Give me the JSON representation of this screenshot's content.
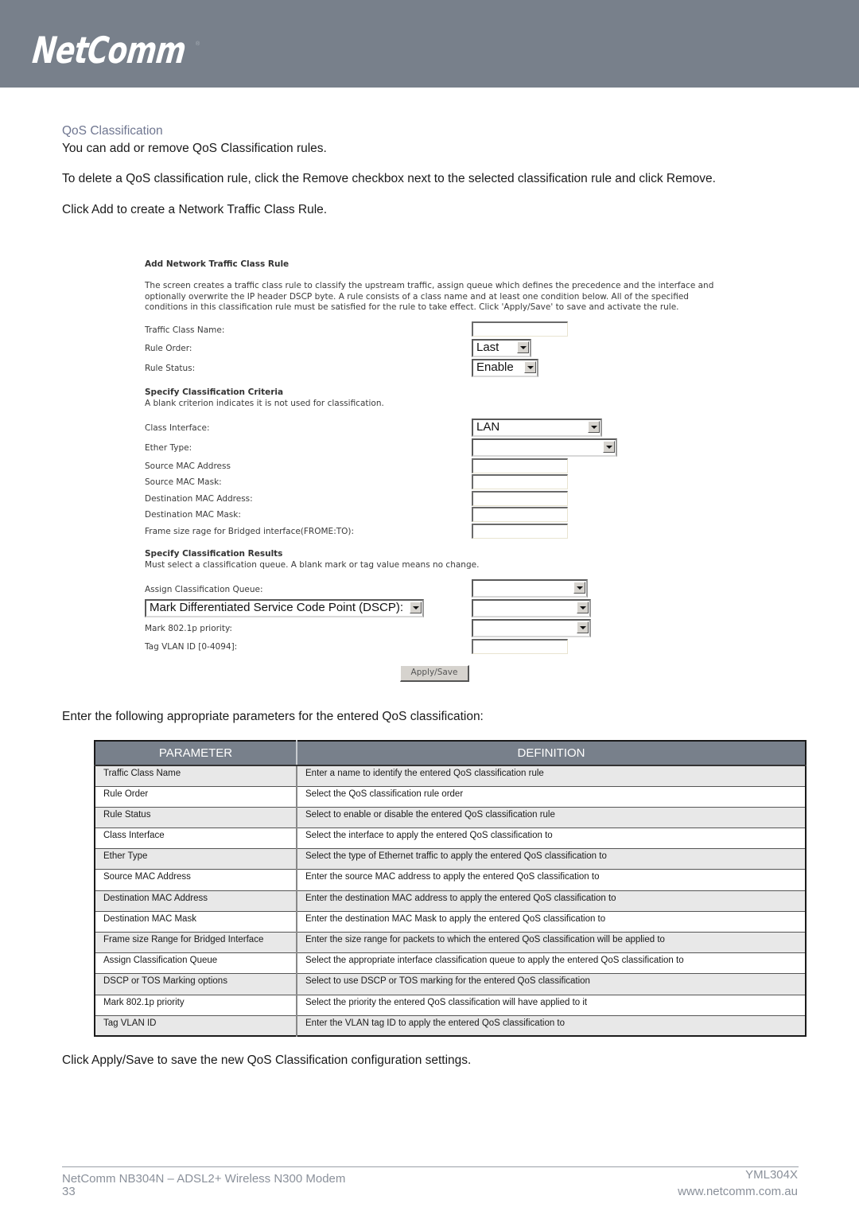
{
  "header": {
    "brand": "NetComm",
    "registered_mark": "®"
  },
  "section": {
    "title": "QoS Classification",
    "paragraphs": [
      "You can add or remove QoS Classification rules.",
      "To delete a QoS classification rule, click the Remove checkbox next to the selected classification rule and click Remove.",
      "Click Add to create a Network Traffic Class Rule."
    ]
  },
  "router_ui": {
    "title": "Add Network Traffic Class Rule",
    "description": "The screen creates a traffic class rule to classify the upstream traffic, assign queue which defines the precedence and the interface and optionally overwrite the IP header DSCP byte. A rule consists of a class name and at least one condition below. All of the specified conditions in this classification rule must be satisfied for the rule to take effect. Click 'Apply/Save' to save and activate the rule.",
    "traffic_class_name_label": "Traffic Class Name:",
    "traffic_class_name_value": "",
    "rule_order_label": "Rule Order:",
    "rule_order_value": "Last",
    "rule_status_label": "Rule Status:",
    "rule_status_value": "Enable",
    "criteria_title": "Specify Classification Criteria",
    "criteria_note": "A blank criterion indicates it is not used for classification.",
    "class_interface_label": "Class Interface:",
    "class_interface_value": "LAN",
    "ether_type_label": "Ether Type:",
    "ether_type_value": "",
    "src_mac_label": "Source MAC Address",
    "src_mac_value": "",
    "src_mask_label": "Source MAC Mask:",
    "src_mask_value": "",
    "dst_mac_label": "Destination MAC Address:",
    "dst_mac_value": "",
    "dst_mask_label": "Destination MAC Mask:",
    "dst_mask_value": "",
    "frame_size_label": "Frame size rage for Bridged interface(FROME:TO):",
    "frame_size_value": "",
    "results_title": "Specify Classification Results",
    "results_note": "Must select a classification queue. A blank mark or tag value means no change.",
    "queue_label": "Assign Classification Queue:",
    "queue_value": "",
    "dscp_select_value": "Mark Differentiated Service Code Point (DSCP):",
    "dscp_value": "",
    "priority_label": "Mark 802.1p priority:",
    "priority_value": "",
    "vlan_label": "Tag VLAN ID [0-4094]:",
    "vlan_value": "",
    "apply_button": "Apply/Save"
  },
  "table_intro": "Enter the following appropriate parameters for the entered QoS classification:",
  "table": {
    "headers": [
      "PARAMETER",
      "DEFINITION"
    ],
    "rows": [
      {
        "param": "Traffic Class Name",
        "definition": "Enter a name to identify the entered QoS classification rule"
      },
      {
        "param": "Rule Order",
        "definition": "Select the QoS classification rule order"
      },
      {
        "param": "Rule Status",
        "definition": "Select to enable or disable the entered QoS classification rule"
      },
      {
        "param": "Class Interface",
        "definition": "Select the interface to apply the entered QoS classification to"
      },
      {
        "param": "Ether Type",
        "definition": "Select the type of Ethernet traffic to apply the entered QoS classification to"
      },
      {
        "param": "Source MAC Address",
        "definition": "Enter the source MAC address to apply the entered QoS classification to"
      },
      {
        "param": "Destination MAC Address",
        "definition": "Enter the destination MAC address to apply the entered QoS classification to"
      },
      {
        "param": "Destination MAC Mask",
        "definition": "Enter the destination MAC Mask to apply the entered QoS classification to"
      },
      {
        "param": "Frame size Range for Bridged Interface",
        "definition": "Enter the size range for packets to which the entered QoS classification will be applied to"
      },
      {
        "param": "Assign Classification Queue",
        "definition": "Select the appropriate interface classification queue to apply the entered QoS classification to"
      },
      {
        "param": "DSCP or TOS Marking options",
        "definition": "Select to use DSCP or TOS marking for the entered QoS classification"
      },
      {
        "param": "Mark 802.1p priority",
        "definition": "Select the priority the entered QoS classification will have applied to it"
      },
      {
        "param": "Tag VLAN ID",
        "definition": "Enter the VLAN tag ID to apply the entered QoS classification to"
      }
    ]
  },
  "closing": "Click Apply/Save to save the new QoS Classification configuration settings.",
  "footer": {
    "product": "NetComm NB304N – ADSL2+ Wireless N300 Modem",
    "page_number": "33",
    "doc_code": "YML304X",
    "website": "www.netcomm.com.au"
  }
}
